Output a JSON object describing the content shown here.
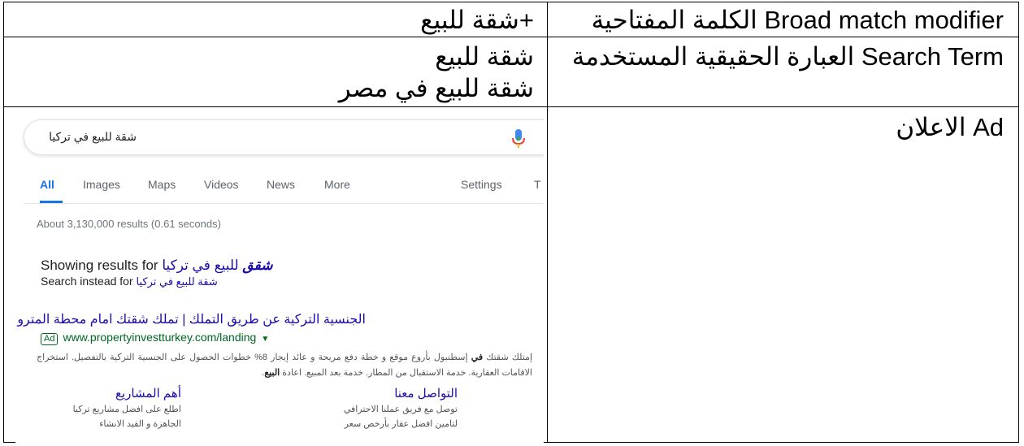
{
  "rows": [
    {
      "label": "Broad match modifier الكلمة المفتاحية",
      "value": "+شقة للبيع"
    },
    {
      "label": "Search Term العبارة الحقيقية المستخدمة",
      "values": [
        "شقة للبيع",
        "شقة للبيع في مصر"
      ]
    },
    {
      "label": "Ad الاعلان"
    }
  ],
  "serp": {
    "query": "شقة للبيع في تركيا",
    "tabs": [
      "All",
      "Images",
      "Maps",
      "Videos",
      "News",
      "More",
      "Settings",
      "T"
    ],
    "active_tab": "All",
    "stats": "About 3,130,000 results (0.61 seconds)",
    "showing_prefix": "Showing results for",
    "showing_corrected_bold": "شقق",
    "showing_corrected_rest": "للبيع في تركيا",
    "instead_prefix": "Search instead for",
    "instead_original": "شقة للبيع في تركيا",
    "ad": {
      "title": "الجنسية التركية عن طريق التملك | تملك شقتك امام محطة المترو",
      "badge": "Ad",
      "url": "www.propertyinvestturkey.com/landing",
      "desc_part1": "إمتلك شقتك",
      "desc_bold1": "في",
      "desc_part2": "إسطنبول بأروع موقع و خطة دفع مريحة و عائد إيجار 8% خطوات الحصول على الجنسية التركية بالتفصيل. استخراج الاقامات العقارية. خدمة الاستقبال من المطار. خدمة بعد المبيع. اعادة",
      "desc_bold2": "البيع",
      "sitelinks": [
        {
          "title": "التواصل معنا",
          "line1": "توصل مع فريق عملنا الاحترافي",
          "line2": "لتامين افضل عقار بأرخص سعر"
        },
        {
          "title": "أهم المشاريع",
          "line1": "اطلع على افضل مشاريع تركيا",
          "line2": "الجاهزة و القيد الانشاء"
        }
      ]
    },
    "colors": {
      "link": "#1a0dab",
      "url": "#006621",
      "accent": "#1a73e8",
      "muted": "#70757a"
    }
  }
}
